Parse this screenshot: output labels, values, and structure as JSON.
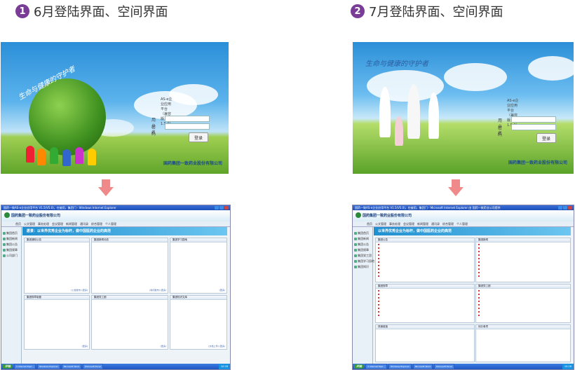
{
  "headers": [
    {
      "number": "1",
      "title": "6月登陆界面、空间界面"
    },
    {
      "number": "2",
      "title": "7月登陆界面、空间界面"
    }
  ],
  "login_june": {
    "slogan": "生命与健康的守护者",
    "system_name": "AS-e企业应用平台（兼容版 1.5.0）",
    "username_label": "用户名",
    "password_label": "密　码",
    "login_button": "登录",
    "company": "国药集团一致药业股份有限公司"
  },
  "login_july": {
    "slogan": "生命与健康的守护者",
    "system_name": "AS-e企业应用平台（兼容版 1.5.0）",
    "username_label": "用户名",
    "password_label": "密　码",
    "login_button": "登录",
    "company": "国药集团一致药业股份有限公司"
  },
  "space_june": {
    "window_title": "国药一致AS-e企业应用平台 V1.5(V5.0)，在被用，集团门 - Windows Internet Explorer",
    "company": "国药集团一致药业股份有限公司",
    "nav": [
      "首页",
      "公文管理",
      "事务处理",
      "会议管理",
      "新闻管理",
      "通讯录",
      "综合管理",
      "个人管理"
    ],
    "sidebar": [
      "集团首页",
      "集团新闻",
      "集团公告",
      "集团规章",
      "公司部门"
    ],
    "banner": "愿景：以世界优秀企业为标杆，做中国医药企业的典范",
    "panels": [
      {
        "title": "集团通知公告",
        "footer": "[公告发布] [更多]"
      },
      {
        "title": "集团新闻动态",
        "footer": "[新闻发布] [更多]"
      },
      {
        "title": "集团学习园地",
        "footer": "[更多]"
      },
      {
        "title": "集团规章制度",
        "footer": "[更多]"
      },
      {
        "title": "集团党工团",
        "footer": "[更多]"
      },
      {
        "title": "集团知识文库",
        "footer": "[文档上传] [更多]"
      }
    ],
    "taskbar": [
      "开始",
      "3 Internet Expl...",
      "Windows Explorer",
      "Microsoft Word",
      "Microsoft Excel"
    ],
    "clock": "10:28"
  },
  "space_july": {
    "window_title": "国药一致AS-e企业应用平台 V1.5(V5.0)，在被用，集团门 - Microsoft Internet Explorer 由 国药一致药业公司提供",
    "company": "国药集团一致药业股份有限公司",
    "nav": [
      "首页",
      "公文管理",
      "事务处理",
      "会议管理",
      "新闻管理",
      "通讯录",
      "综合管理",
      "个人管理"
    ],
    "sidebar": [
      "集团首页",
      "集团新闻",
      "集团公告",
      "集团规章",
      "集团党工团",
      "集团学习园地",
      "集团知识"
    ],
    "banner": "以世界优秀企业为标杆，做中国医药企业的典范",
    "panels": [
      {
        "title": "集团公告",
        "footer": ""
      },
      {
        "title": "集团新闻",
        "footer": ""
      },
      {
        "title": "集团规章",
        "footer": ""
      },
      {
        "title": "集团党工团",
        "footer": ""
      },
      {
        "title": "快速链接",
        "footer": ""
      },
      {
        "title": "待办事项",
        "footer": ""
      }
    ],
    "taskbar": [
      "开始",
      "3 Internet Expl...",
      "Windows Explorer",
      "Microsoft Word",
      "Microsoft Excel"
    ],
    "clock": "10:28"
  }
}
